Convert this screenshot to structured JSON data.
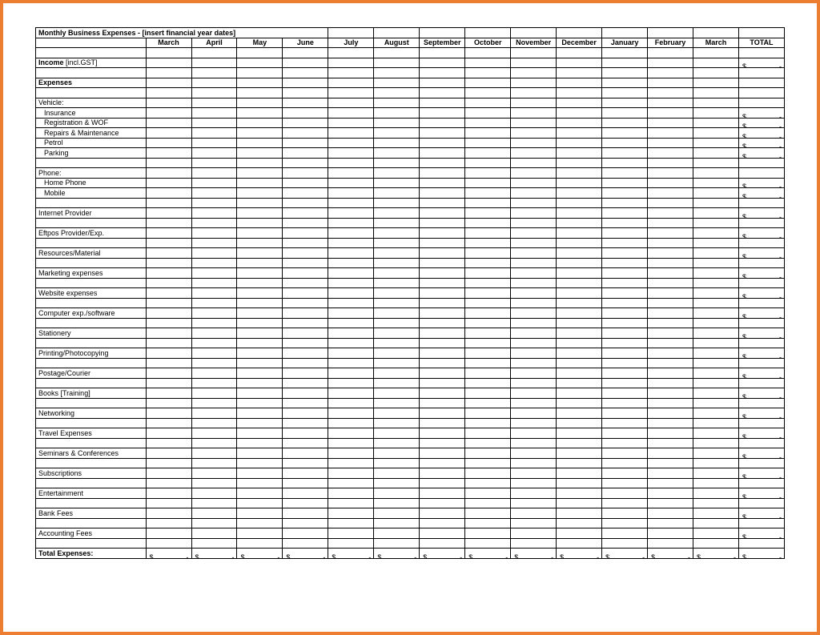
{
  "title": "Monthly Business Expenses - [insert financial year dates]",
  "months": [
    "March",
    "April",
    "May",
    "June",
    "July",
    "August",
    "September",
    "October",
    "November",
    "December",
    "January",
    "February",
    "March"
  ],
  "totalHeader": "TOTAL",
  "currency": "$",
  "dash": "-",
  "rows": [
    {
      "type": "blank"
    },
    {
      "type": "total",
      "label": "Income [incl.GST]",
      "boldPart": "Income",
      "rest": " [incl.GST]"
    },
    {
      "type": "blank"
    },
    {
      "type": "heading",
      "label": "Expenses"
    },
    {
      "type": "blank"
    },
    {
      "type": "label",
      "label": "Vehicle:"
    },
    {
      "type": "item",
      "label": "Insurance"
    },
    {
      "type": "item",
      "label": "Registration & WOF"
    },
    {
      "type": "item",
      "label": "Repairs & Maintenance"
    },
    {
      "type": "item",
      "label": "Petrol"
    },
    {
      "type": "item",
      "label": "Parking"
    },
    {
      "type": "blank"
    },
    {
      "type": "label",
      "label": "Phone:"
    },
    {
      "type": "item",
      "label": "Home Phone"
    },
    {
      "type": "item",
      "label": "Mobile"
    },
    {
      "type": "blank"
    },
    {
      "type": "item-flat",
      "label": "Internet Provider"
    },
    {
      "type": "blank"
    },
    {
      "type": "item-flat",
      "label": "Eftpos Provider/Exp."
    },
    {
      "type": "blank"
    },
    {
      "type": "item-flat",
      "label": "Resources/Material"
    },
    {
      "type": "blank"
    },
    {
      "type": "item-flat",
      "label": "Marketing expenses"
    },
    {
      "type": "blank"
    },
    {
      "type": "item-flat",
      "label": "Website expenses"
    },
    {
      "type": "blank"
    },
    {
      "type": "item-flat",
      "label": "Computer exp./software"
    },
    {
      "type": "blank"
    },
    {
      "type": "item-flat",
      "label": "Stationery"
    },
    {
      "type": "blank"
    },
    {
      "type": "item-flat",
      "label": "Printing/Photocopying"
    },
    {
      "type": "blank"
    },
    {
      "type": "item-flat",
      "label": "Postage/Courier"
    },
    {
      "type": "blank"
    },
    {
      "type": "item-flat",
      "label": "Books [Training]"
    },
    {
      "type": "blank"
    },
    {
      "type": "item-flat",
      "label": "Networking"
    },
    {
      "type": "blank"
    },
    {
      "type": "item-flat",
      "label": "Travel Expenses"
    },
    {
      "type": "blank"
    },
    {
      "type": "item-flat",
      "label": "Seminars & Conferences"
    },
    {
      "type": "blank"
    },
    {
      "type": "item-flat",
      "label": "Subscriptions"
    },
    {
      "type": "blank"
    },
    {
      "type": "item-flat",
      "label": "Entertainment"
    },
    {
      "type": "blank"
    },
    {
      "type": "item-flat",
      "label": "Bank Fees"
    },
    {
      "type": "blank"
    },
    {
      "type": "item-flat",
      "label": "Accounting Fees"
    },
    {
      "type": "blank"
    },
    {
      "type": "grandtotal",
      "label": "Total Expenses:"
    }
  ]
}
